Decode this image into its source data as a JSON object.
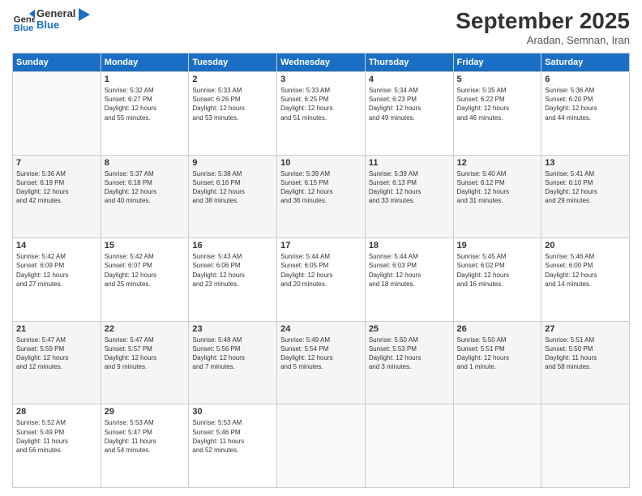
{
  "logo": {
    "general": "General",
    "blue": "Blue"
  },
  "header": {
    "month": "September 2025",
    "location": "Aradan, Semnan, Iran"
  },
  "weekdays": [
    "Sunday",
    "Monday",
    "Tuesday",
    "Wednesday",
    "Thursday",
    "Friday",
    "Saturday"
  ],
  "weeks": [
    [
      {
        "num": "",
        "detail": ""
      },
      {
        "num": "1",
        "detail": "Sunrise: 5:32 AM\nSunset: 6:27 PM\nDaylight: 12 hours\nand 55 minutes."
      },
      {
        "num": "2",
        "detail": "Sunrise: 5:33 AM\nSunset: 6:26 PM\nDaylight: 12 hours\nand 53 minutes."
      },
      {
        "num": "3",
        "detail": "Sunrise: 5:33 AM\nSunset: 6:25 PM\nDaylight: 12 hours\nand 51 minutes."
      },
      {
        "num": "4",
        "detail": "Sunrise: 5:34 AM\nSunset: 6:23 PM\nDaylight: 12 hours\nand 49 minutes."
      },
      {
        "num": "5",
        "detail": "Sunrise: 5:35 AM\nSunset: 6:22 PM\nDaylight: 12 hours\nand 46 minutes."
      },
      {
        "num": "6",
        "detail": "Sunrise: 5:36 AM\nSunset: 6:20 PM\nDaylight: 12 hours\nand 44 minutes."
      }
    ],
    [
      {
        "num": "7",
        "detail": "Sunrise: 5:36 AM\nSunset: 6:19 PM\nDaylight: 12 hours\nand 42 minutes."
      },
      {
        "num": "8",
        "detail": "Sunrise: 5:37 AM\nSunset: 6:18 PM\nDaylight: 12 hours\nand 40 minutes."
      },
      {
        "num": "9",
        "detail": "Sunrise: 5:38 AM\nSunset: 6:16 PM\nDaylight: 12 hours\nand 38 minutes."
      },
      {
        "num": "10",
        "detail": "Sunrise: 5:39 AM\nSunset: 6:15 PM\nDaylight: 12 hours\nand 36 minutes."
      },
      {
        "num": "11",
        "detail": "Sunrise: 5:39 AM\nSunset: 6:13 PM\nDaylight: 12 hours\nand 33 minutes."
      },
      {
        "num": "12",
        "detail": "Sunrise: 5:40 AM\nSunset: 6:12 PM\nDaylight: 12 hours\nand 31 minutes."
      },
      {
        "num": "13",
        "detail": "Sunrise: 5:41 AM\nSunset: 6:10 PM\nDaylight: 12 hours\nand 29 minutes."
      }
    ],
    [
      {
        "num": "14",
        "detail": "Sunrise: 5:42 AM\nSunset: 6:09 PM\nDaylight: 12 hours\nand 27 minutes."
      },
      {
        "num": "15",
        "detail": "Sunrise: 5:42 AM\nSunset: 6:07 PM\nDaylight: 12 hours\nand 25 minutes."
      },
      {
        "num": "16",
        "detail": "Sunrise: 5:43 AM\nSunset: 6:06 PM\nDaylight: 12 hours\nand 23 minutes."
      },
      {
        "num": "17",
        "detail": "Sunrise: 5:44 AM\nSunset: 6:05 PM\nDaylight: 12 hours\nand 20 minutes."
      },
      {
        "num": "18",
        "detail": "Sunrise: 5:44 AM\nSunset: 6:03 PM\nDaylight: 12 hours\nand 18 minutes."
      },
      {
        "num": "19",
        "detail": "Sunrise: 5:45 AM\nSunset: 6:02 PM\nDaylight: 12 hours\nand 16 minutes."
      },
      {
        "num": "20",
        "detail": "Sunrise: 5:46 AM\nSunset: 6:00 PM\nDaylight: 12 hours\nand 14 minutes."
      }
    ],
    [
      {
        "num": "21",
        "detail": "Sunrise: 5:47 AM\nSunset: 5:59 PM\nDaylight: 12 hours\nand 12 minutes."
      },
      {
        "num": "22",
        "detail": "Sunrise: 5:47 AM\nSunset: 5:57 PM\nDaylight: 12 hours\nand 9 minutes."
      },
      {
        "num": "23",
        "detail": "Sunrise: 5:48 AM\nSunset: 5:56 PM\nDaylight: 12 hours\nand 7 minutes."
      },
      {
        "num": "24",
        "detail": "Sunrise: 5:49 AM\nSunset: 5:54 PM\nDaylight: 12 hours\nand 5 minutes."
      },
      {
        "num": "25",
        "detail": "Sunrise: 5:50 AM\nSunset: 5:53 PM\nDaylight: 12 hours\nand 3 minutes."
      },
      {
        "num": "26",
        "detail": "Sunrise: 5:50 AM\nSunset: 5:51 PM\nDaylight: 12 hours\nand 1 minute."
      },
      {
        "num": "27",
        "detail": "Sunrise: 5:51 AM\nSunset: 5:50 PM\nDaylight: 11 hours\nand 58 minutes."
      }
    ],
    [
      {
        "num": "28",
        "detail": "Sunrise: 5:52 AM\nSunset: 5:49 PM\nDaylight: 11 hours\nand 56 minutes."
      },
      {
        "num": "29",
        "detail": "Sunrise: 5:53 AM\nSunset: 5:47 PM\nDaylight: 11 hours\nand 54 minutes."
      },
      {
        "num": "30",
        "detail": "Sunrise: 5:53 AM\nSunset: 5:46 PM\nDaylight: 11 hours\nand 52 minutes."
      },
      {
        "num": "",
        "detail": ""
      },
      {
        "num": "",
        "detail": ""
      },
      {
        "num": "",
        "detail": ""
      },
      {
        "num": "",
        "detail": ""
      }
    ]
  ]
}
